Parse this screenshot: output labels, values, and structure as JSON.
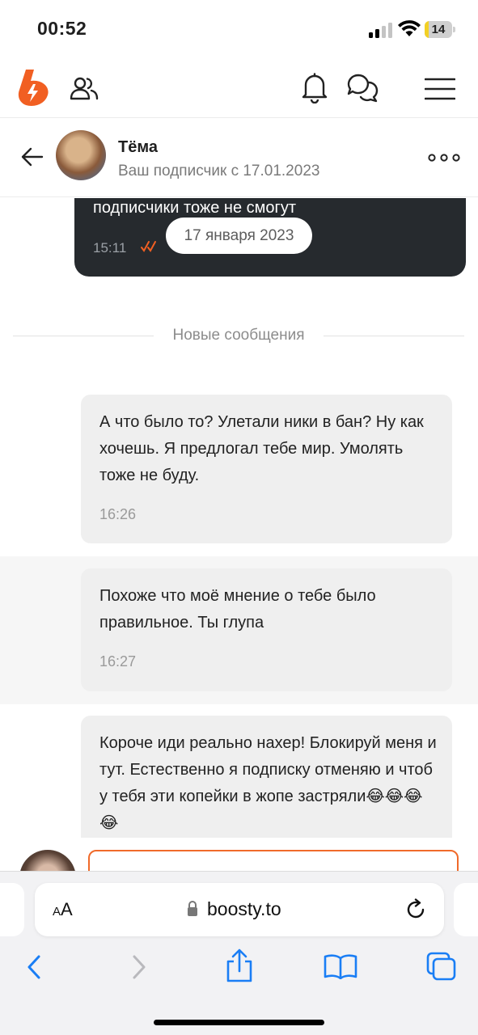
{
  "status_bar": {
    "time": "00:52",
    "battery": "14",
    "battery_level": 0.14
  },
  "colors": {
    "accent": "#f15f22",
    "outgoing_bubble": "#262a2e",
    "incoming_bubble": "#efefef"
  },
  "header": {
    "icons": [
      "boosty-logo-icon",
      "people-icon",
      "bell-icon",
      "chat-bubbles-icon",
      "menu-icon"
    ]
  },
  "chat": {
    "name": "Тёма",
    "subtitle": "Ваш подписчик с 17.01.2023",
    "more_icon": "more-dots-icon",
    "back_icon": "back-arrow-icon"
  },
  "messages": {
    "outgoing": {
      "text": "подписчики тоже не смогут",
      "time": "15:11"
    },
    "date_pill": "17 января 2023",
    "new_divider": "Новые сообщения",
    "incoming": [
      {
        "text": "А что было то? Улетали ники в бан? Ну как хочешь. Я предлогал тебе мир. Умолять тоже не буду.",
        "time": "16:26"
      },
      {
        "text": "Похоже что моё мнение о тебе было правильное. Ты глупа",
        "time": "16:27"
      },
      {
        "text": "Короче иди реально нахер! Блокируй меня и тут. Естественно я подписку отменяю и чтоб у тебя эти копейки в жопе застряли😂😂😂😂",
        "time": ""
      }
    ]
  },
  "safari": {
    "aa_small": "A",
    "aa_large": "A",
    "domain": "boosty.to",
    "toolbar": [
      "back-icon",
      "forward-icon",
      "share-icon",
      "bookmarks-icon",
      "tabs-icon"
    ]
  }
}
